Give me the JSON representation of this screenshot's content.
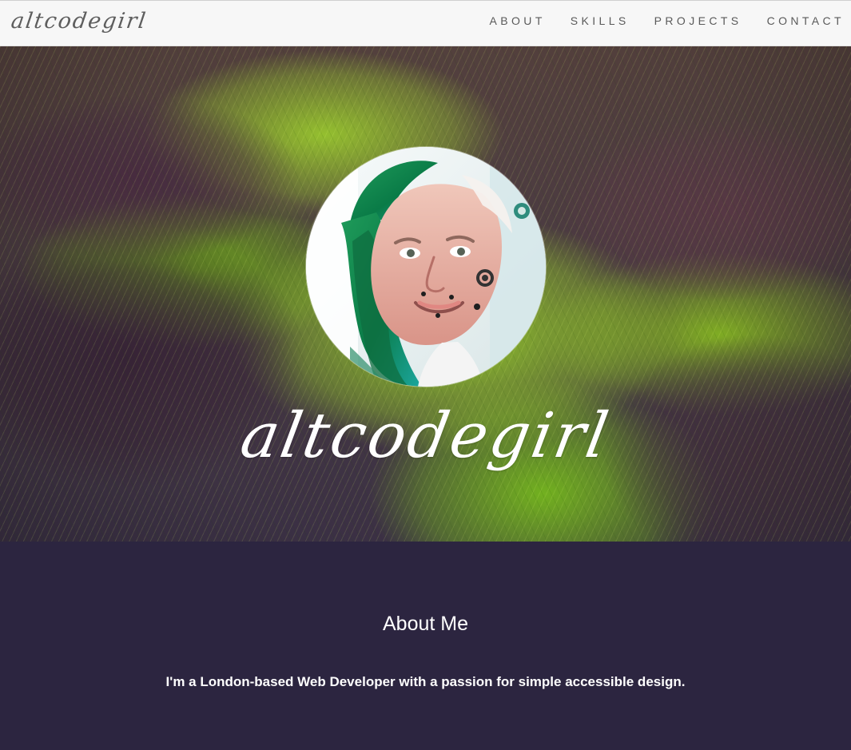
{
  "navbar": {
    "brand": "altcodegirl",
    "links": [
      "ABOUT",
      "SKILLS",
      "PROJECTS",
      "CONTACT"
    ]
  },
  "hero": {
    "title": "altcodegirl"
  },
  "about": {
    "heading": "About Me",
    "text": "I'm a London-based Web Developer with a passion for simple accessible design."
  }
}
